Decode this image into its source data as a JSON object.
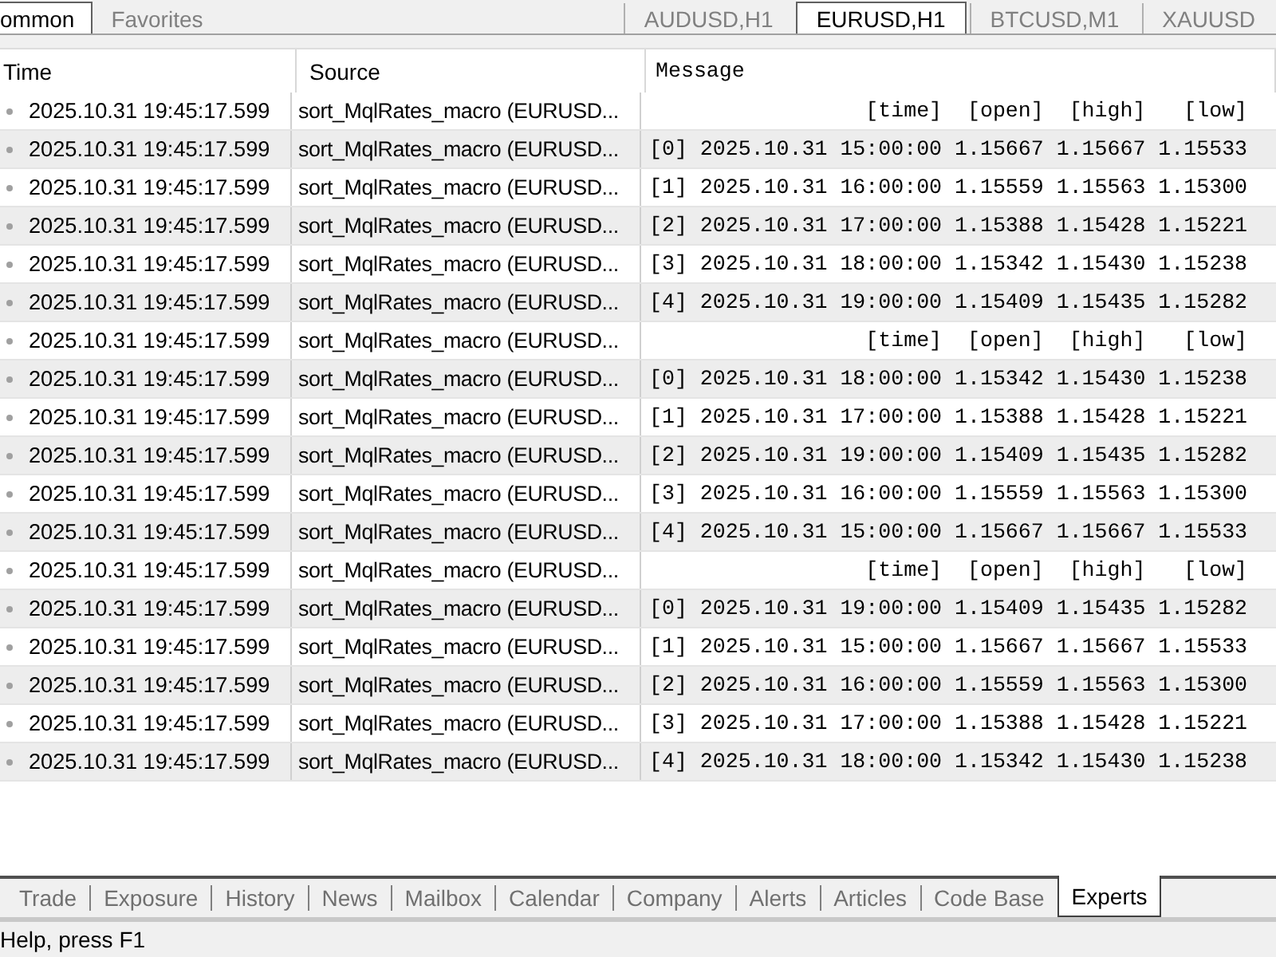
{
  "top_tabs_left": [
    {
      "label": "ommon",
      "selected": true
    },
    {
      "label": "Favorites",
      "selected": false
    }
  ],
  "chart_tabs": [
    {
      "label": "AUDUSD,H1",
      "selected": false
    },
    {
      "label": "EURUSD,H1",
      "selected": true
    },
    {
      "label": "BTCUSD,M1",
      "selected": false
    },
    {
      "label": "XAUUSD",
      "selected": false
    }
  ],
  "table": {
    "columns": [
      "Time",
      "Source",
      "Message"
    ],
    "rows": [
      {
        "time": "2025.10.31 19:45:17.599",
        "source": "sort_MqlRates_macro (EURUSD...",
        "message": "                 [time]  [open]  [high]   [low]"
      },
      {
        "time": "2025.10.31 19:45:17.599",
        "source": "sort_MqlRates_macro (EURUSD...",
        "message": "[0] 2025.10.31 15:00:00 1.15667 1.15667 1.15533"
      },
      {
        "time": "2025.10.31 19:45:17.599",
        "source": "sort_MqlRates_macro (EURUSD...",
        "message": "[1] 2025.10.31 16:00:00 1.15559 1.15563 1.15300"
      },
      {
        "time": "2025.10.31 19:45:17.599",
        "source": "sort_MqlRates_macro (EURUSD...",
        "message": "[2] 2025.10.31 17:00:00 1.15388 1.15428 1.15221"
      },
      {
        "time": "2025.10.31 19:45:17.599",
        "source": "sort_MqlRates_macro (EURUSD...",
        "message": "[3] 2025.10.31 18:00:00 1.15342 1.15430 1.15238"
      },
      {
        "time": "2025.10.31 19:45:17.599",
        "source": "sort_MqlRates_macro (EURUSD...",
        "message": "[4] 2025.10.31 19:00:00 1.15409 1.15435 1.15282"
      },
      {
        "time": "2025.10.31 19:45:17.599",
        "source": "sort_MqlRates_macro (EURUSD...",
        "message": "                 [time]  [open]  [high]   [low]"
      },
      {
        "time": "2025.10.31 19:45:17.599",
        "source": "sort_MqlRates_macro (EURUSD...",
        "message": "[0] 2025.10.31 18:00:00 1.15342 1.15430 1.15238"
      },
      {
        "time": "2025.10.31 19:45:17.599",
        "source": "sort_MqlRates_macro (EURUSD...",
        "message": "[1] 2025.10.31 17:00:00 1.15388 1.15428 1.15221"
      },
      {
        "time": "2025.10.31 19:45:17.599",
        "source": "sort_MqlRates_macro (EURUSD...",
        "message": "[2] 2025.10.31 19:00:00 1.15409 1.15435 1.15282"
      },
      {
        "time": "2025.10.31 19:45:17.599",
        "source": "sort_MqlRates_macro (EURUSD...",
        "message": "[3] 2025.10.31 16:00:00 1.15559 1.15563 1.15300"
      },
      {
        "time": "2025.10.31 19:45:17.599",
        "source": "sort_MqlRates_macro (EURUSD...",
        "message": "[4] 2025.10.31 15:00:00 1.15667 1.15667 1.15533"
      },
      {
        "time": "2025.10.31 19:45:17.599",
        "source": "sort_MqlRates_macro (EURUSD...",
        "message": "                 [time]  [open]  [high]   [low]"
      },
      {
        "time": "2025.10.31 19:45:17.599",
        "source": "sort_MqlRates_macro (EURUSD...",
        "message": "[0] 2025.10.31 19:00:00 1.15409 1.15435 1.15282"
      },
      {
        "time": "2025.10.31 19:45:17.599",
        "source": "sort_MqlRates_macro (EURUSD...",
        "message": "[1] 2025.10.31 15:00:00 1.15667 1.15667 1.15533"
      },
      {
        "time": "2025.10.31 19:45:17.599",
        "source": "sort_MqlRates_macro (EURUSD...",
        "message": "[2] 2025.10.31 16:00:00 1.15559 1.15563 1.15300"
      },
      {
        "time": "2025.10.31 19:45:17.599",
        "source": "sort_MqlRates_macro (EURUSD...",
        "message": "[3] 2025.10.31 17:00:00 1.15388 1.15428 1.15221"
      },
      {
        "time": "2025.10.31 19:45:17.599",
        "source": "sort_MqlRates_macro (EURUSD...",
        "message": "[4] 2025.10.31 18:00:00 1.15342 1.15430 1.15238"
      }
    ]
  },
  "bottom_tabs": [
    {
      "label": "Trade",
      "selected": false
    },
    {
      "label": "Exposure",
      "selected": false
    },
    {
      "label": "History",
      "selected": false
    },
    {
      "label": "News",
      "selected": false
    },
    {
      "label": "Mailbox",
      "selected": false
    },
    {
      "label": "Calendar",
      "selected": false
    },
    {
      "label": "Company",
      "selected": false
    },
    {
      "label": "Alerts",
      "selected": false
    },
    {
      "label": "Articles",
      "selected": false
    },
    {
      "label": "Code Base",
      "selected": false
    },
    {
      "label": "Experts",
      "selected": true
    }
  ],
  "status_bar": "Help, press F1"
}
